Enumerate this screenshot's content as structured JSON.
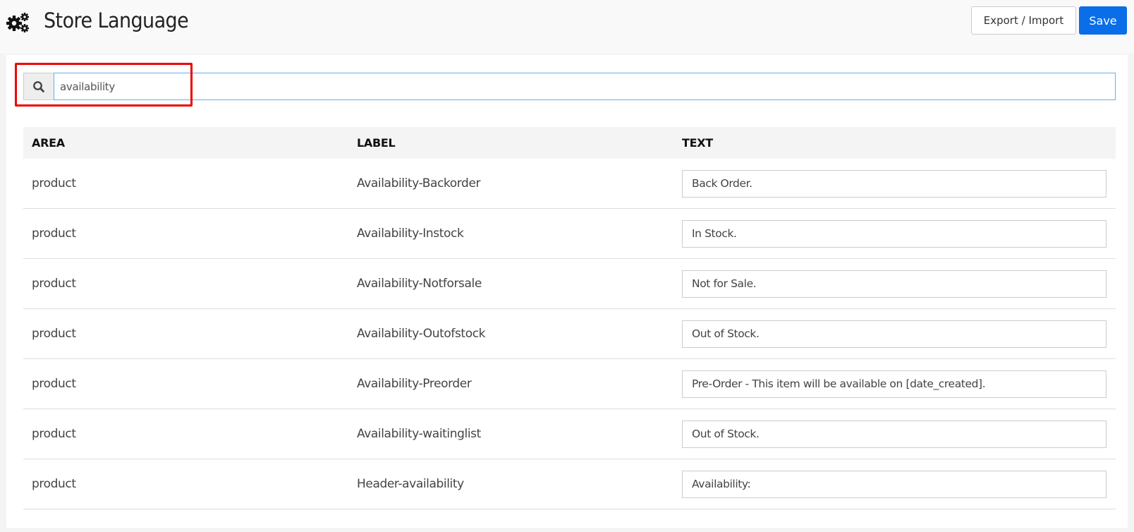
{
  "header": {
    "title": "Store Language",
    "icon": "gears-icon",
    "buttons": {
      "export_import": "Export / Import",
      "save": "Save"
    }
  },
  "search": {
    "icon": "search-icon",
    "value": "availability",
    "placeholder": ""
  },
  "table": {
    "columns": [
      "AREA",
      "LABEL",
      "TEXT"
    ],
    "rows": [
      {
        "area": "product",
        "label": "Availability-Backorder",
        "text": "Back Order."
      },
      {
        "area": "product",
        "label": "Availability-Instock",
        "text": "In Stock."
      },
      {
        "area": "product",
        "label": "Availability-Notforsale",
        "text": "Not for Sale."
      },
      {
        "area": "product",
        "label": "Availability-Outofstock",
        "text": "Out of Stock."
      },
      {
        "area": "product",
        "label": "Availability-Preorder",
        "text": "Pre-Order - This item will be available on [date_created]."
      },
      {
        "area": "product",
        "label": "Availability-waitinglist",
        "text": "Out of Stock."
      },
      {
        "area": "product",
        "label": "Header-availability",
        "text": "Availability:"
      }
    ]
  },
  "colors": {
    "primary": "#0a6ee8",
    "highlight": "#ee0000",
    "focus_border": "#66afe9"
  }
}
